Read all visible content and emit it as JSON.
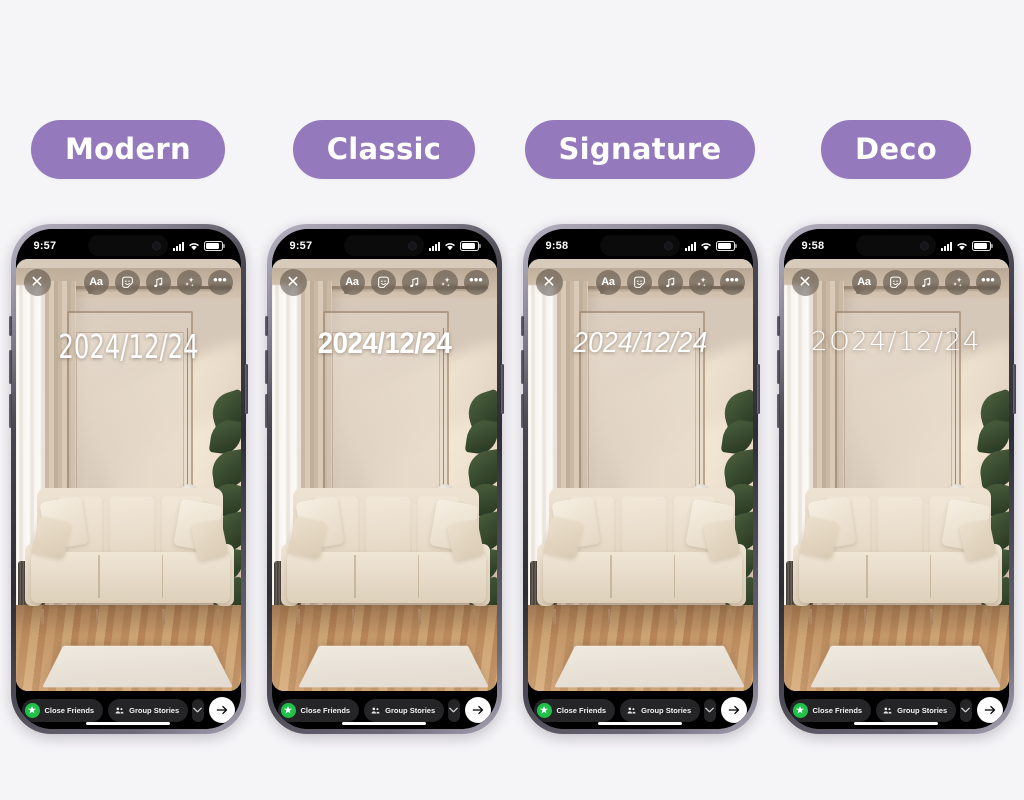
{
  "background_color": "#f5f4f7",
  "accent_color": "#9479bd",
  "styles": [
    {
      "id": "modern",
      "label": "Modern",
      "time": "9:57",
      "date_text": "2024/12/24"
    },
    {
      "id": "classic",
      "label": "Classic",
      "time": "9:57",
      "date_text": "2024/12/24"
    },
    {
      "id": "signature",
      "label": "Signature",
      "time": "9:58",
      "date_text": "2024/12/24"
    },
    {
      "id": "deco",
      "label": "Deco",
      "time": "9:58",
      "date_text": "2O24/12/24"
    }
  ],
  "status_bar": {
    "signal_icon": "cellular-signal-icon",
    "wifi_icon": "wifi-icon",
    "battery_icon": "battery-icon"
  },
  "toolbar": {
    "close_label": "✕",
    "text_label": "Aa",
    "sticker_icon": "sticker-icon",
    "music_icon": "music-note-icon",
    "effects_icon": "sparkles-icon",
    "more_label": "•••"
  },
  "bottom_bar": {
    "close_friends_label": "Close Friends",
    "close_friends_icon": "green-star-icon",
    "group_stories_label": "Group Stories",
    "group_stories_icon": "people-group-icon",
    "expand_icon": "chevron-down-icon",
    "send_icon": "arrow-right-icon"
  }
}
